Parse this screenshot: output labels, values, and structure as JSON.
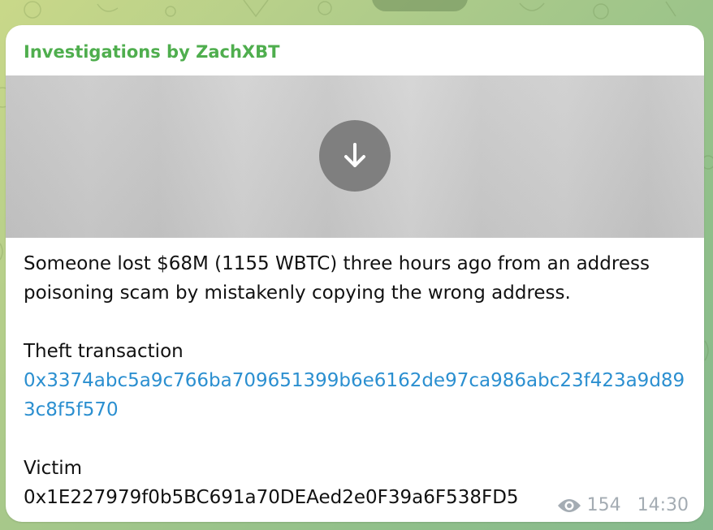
{
  "channel": {
    "name": "Investigations by ZachXBT"
  },
  "message": {
    "paragraph1": "Someone lost $68M (1155 WBTC) three hours ago from an address poisoning scam by mistakenly copying the wrong address.",
    "theft_label": "Theft transaction",
    "theft_hash": "0x3374abc5a9c766ba709651399b6e6162de97ca986abc23f423a9d893c8f5f570",
    "victim_label": "Victim",
    "victim_address": "0x1E227979f0b5BC691a70DEAed2e0F39a6F538FD5"
  },
  "meta": {
    "views": "154",
    "time": "14:30"
  },
  "icons": {
    "download": "arrow-down-icon",
    "views": "eye-icon"
  },
  "colors": {
    "channel_name": "#4fae4e",
    "link": "#2b8fd0",
    "meta": "#a4acb3",
    "card": "#ffffff"
  }
}
